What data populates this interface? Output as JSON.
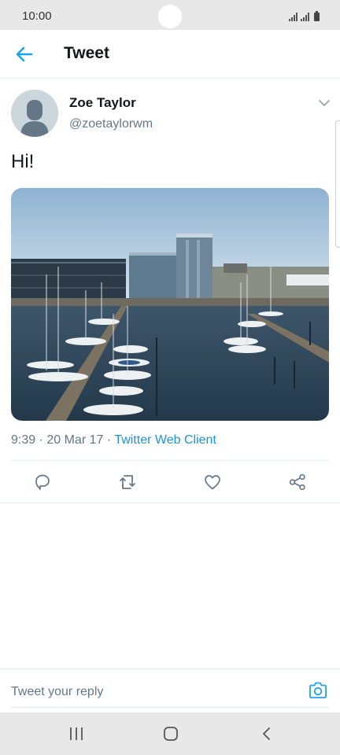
{
  "status_bar": {
    "time": "10:00",
    "icons": [
      "signal-icon",
      "signal-icon",
      "battery-icon"
    ]
  },
  "header": {
    "back_icon": "arrow-left-icon",
    "title": "Tweet",
    "accent_color": "#1da1f2"
  },
  "tweet": {
    "author": {
      "name": "Zoe Taylor",
      "handle": "@zoetaylorwm",
      "avatar_icon": "default-avatar-icon"
    },
    "more_icon": "chevron-down-icon",
    "text": "Hi!",
    "media": {
      "type": "photo",
      "subject": "marina with sailboats and office buildings"
    },
    "meta": {
      "time": "9:39",
      "separator": " · ",
      "date": "20 Mar 17",
      "source": "Twitter Web Client",
      "source_color": "#1b95e0"
    },
    "actions": [
      {
        "name": "reply",
        "icon": "reply-icon"
      },
      {
        "name": "retweet",
        "icon": "retweet-icon"
      },
      {
        "name": "like",
        "icon": "heart-icon"
      },
      {
        "name": "share",
        "icon": "share-icon"
      }
    ]
  },
  "reply_bar": {
    "placeholder": "Tweet your reply",
    "camera_icon": "camera-icon"
  },
  "nav_bar": {
    "buttons": [
      "recent-apps-icon",
      "home-icon",
      "back-icon"
    ]
  }
}
